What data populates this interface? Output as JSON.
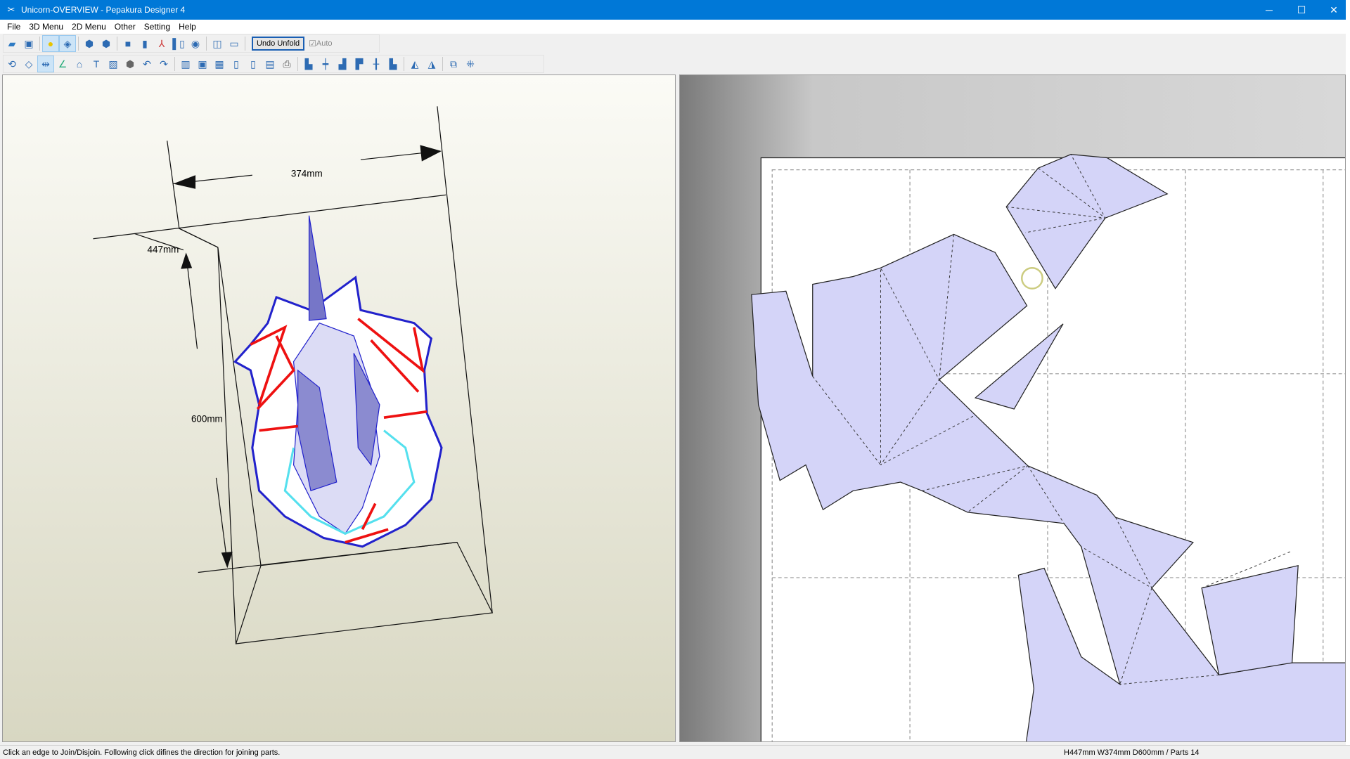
{
  "window": {
    "title": "Unicorn-OVERVIEW - Pepakura Designer 4",
    "minimize": "─",
    "maximize": "☐",
    "close": "✕"
  },
  "menu": [
    "File",
    "3D Menu",
    "2D Menu",
    "Other",
    "Setting",
    "Help"
  ],
  "toolbar": {
    "undo_unfold": "Undo Unfold",
    "auto_label": "Auto",
    "auto_checked": true
  },
  "view3d": {
    "width_label": "374mm",
    "height_label": "447mm",
    "depth_label": "600mm"
  },
  "status": {
    "message": "Click an edge to Join/Disjoin. Following click difines the direction for joining parts.",
    "dimensions": "H447mm W374mm D600mm / Parts 14"
  },
  "colors": {
    "title_bar": "#0078d7",
    "part_fill": "#d4d4f8",
    "cut_edge": "#ee1111",
    "model_edge": "#2222cc"
  }
}
